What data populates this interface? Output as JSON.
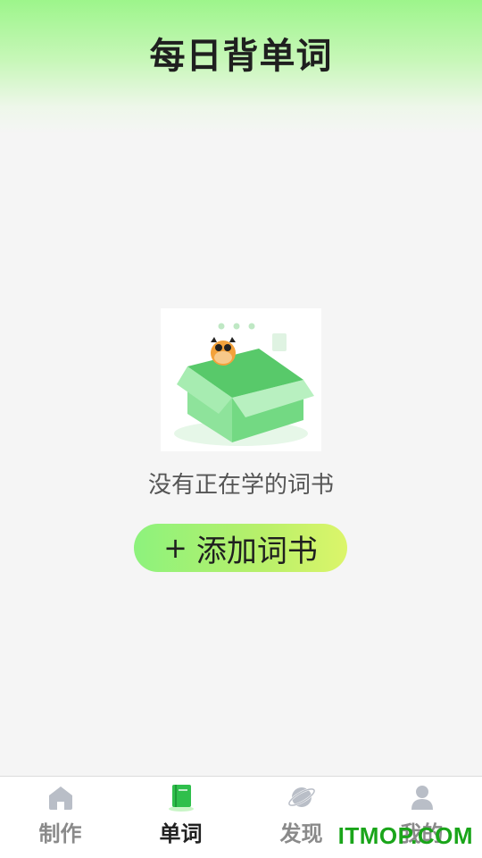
{
  "header": {
    "title": "每日背单词"
  },
  "empty_state": {
    "illustration": "box-with-cow-illustration",
    "message": "没有正在学的词书",
    "add_button": {
      "plus": "+",
      "label": "添加词书"
    }
  },
  "tabbar": {
    "items": [
      {
        "label": "制作",
        "icon": "home-icon",
        "active": false
      },
      {
        "label": "单词",
        "icon": "book-icon",
        "active": true
      },
      {
        "label": "发现",
        "icon": "planet-icon",
        "active": false
      },
      {
        "label": "我的",
        "icon": "user-icon",
        "active": false
      }
    ]
  },
  "watermark": "ITMOP.COM",
  "colors": {
    "accent": "#8df27d",
    "active_tab": "#3fcf5a",
    "inactive_icon": "#b9bec7"
  }
}
